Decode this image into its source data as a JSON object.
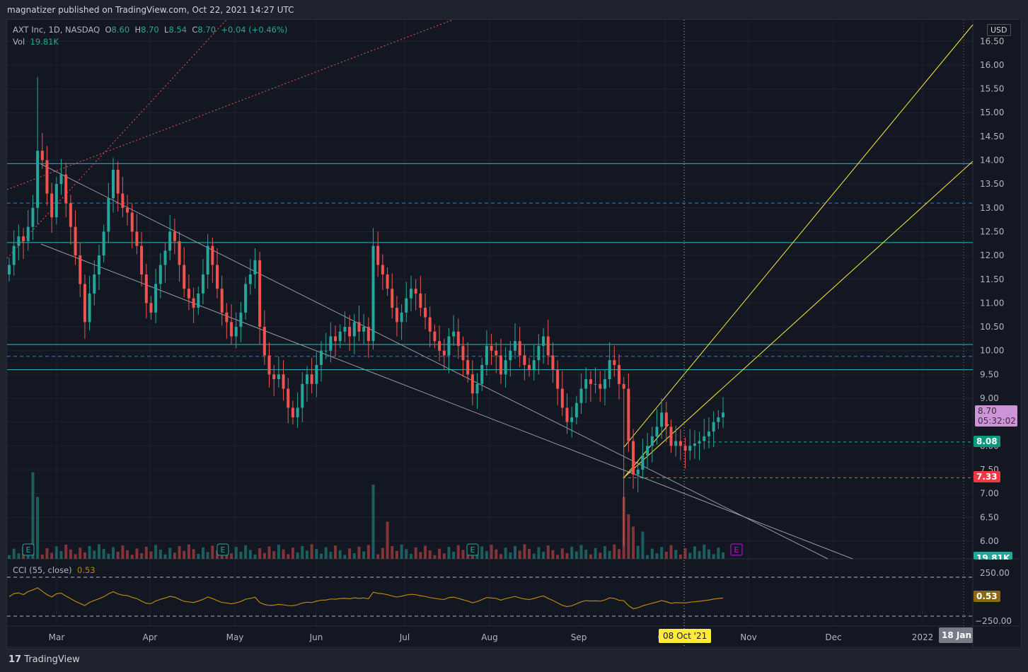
{
  "header": {
    "published": "magnatizer published on TradingView.com, Oct 22, 2021 14:27 UTC"
  },
  "legend": {
    "symbol": "AXT Inc, 1D, NASDAQ",
    "o_label": "O",
    "o": "8.60",
    "h_label": "H",
    "h": "8.70",
    "l_label": "L",
    "l": "8.54",
    "c_label": "C",
    "c": "8.70",
    "change": "+0.04 (+0.46%)",
    "vol_label": "Vol",
    "vol": "19.81K"
  },
  "currency": "USD",
  "price_tags": {
    "last": "8.70",
    "countdown": "05:32:02",
    "green": "8.08",
    "red": "7.33",
    "volume": "19.81K",
    "cci": "0.53"
  },
  "cci": {
    "label": "CCI (55, close)",
    "value": "0.53",
    "upper": "250.00",
    "lower": "−250.00"
  },
  "crosshair_date": "08 Oct '21",
  "end_date": "18 Jan '",
  "brand": "TradingView",
  "earnings_marker": "E",
  "colors": {
    "up": "#26a69a",
    "down": "#ef5350",
    "cci": "#b8860b",
    "level": "#2fb8c9",
    "trend": "#ffeb3b"
  },
  "chart_data": {
    "type": "candlestick",
    "title": "AXT Inc, 1D, NASDAQ",
    "ylim": [
      5.6,
      17.0
    ],
    "y_ticks": [
      6.0,
      6.5,
      7.0,
      7.5,
      8.0,
      8.5,
      9.0,
      9.5,
      10.0,
      10.5,
      11.0,
      11.5,
      12.0,
      12.5,
      13.0,
      13.5,
      14.0,
      14.5,
      15.0,
      15.5,
      16.0,
      16.5
    ],
    "x_ticks": [
      "Mar",
      "Apr",
      "May",
      "Jun",
      "Jul",
      "Aug",
      "Sep",
      "Oct",
      "Nov",
      "Dec",
      "2022"
    ],
    "closes": [
      11.8,
      12.2,
      12.4,
      12.3,
      12.6,
      13.0,
      14.2,
      14.0,
      13.3,
      12.8,
      13.5,
      13.7,
      13.1,
      12.6,
      12.0,
      11.4,
      10.6,
      11.2,
      11.6,
      12.0,
      12.5,
      13.2,
      13.8,
      13.3,
      13.0,
      12.9,
      12.5,
      12.2,
      11.6,
      11.0,
      10.8,
      11.4,
      11.8,
      12.1,
      12.5,
      12.3,
      11.8,
      11.3,
      11.1,
      10.9,
      11.2,
      11.6,
      12.2,
      11.8,
      11.3,
      10.8,
      10.6,
      10.3,
      10.5,
      10.8,
      11.4,
      11.6,
      11.9,
      10.5,
      9.9,
      9.5,
      9.4,
      9.5,
      9.2,
      8.8,
      8.6,
      8.8,
      9.3,
      9.5,
      9.3,
      9.7,
      10.0,
      10.0,
      10.3,
      10.2,
      10.4,
      10.5,
      10.3,
      10.6,
      10.4,
      10.5,
      10.2,
      12.2,
      11.8,
      11.6,
      11.3,
      10.9,
      10.6,
      10.8,
      11.1,
      11.3,
      11.2,
      10.9,
      10.7,
      10.4,
      10.2,
      10.0,
      9.9,
      10.3,
      10.4,
      10.1,
      9.8,
      9.5,
      9.1,
      9.3,
      9.7,
      10.1,
      10.0,
      9.9,
      9.5,
      9.8,
      10.0,
      10.2,
      9.9,
      9.7,
      9.6,
      9.8,
      10.1,
      10.3,
      9.9,
      9.6,
      9.2,
      8.8,
      8.5,
      8.6,
      8.9,
      9.2,
      9.4,
      9.3,
      9.3,
      9.2,
      9.4,
      9.8,
      9.7,
      9.3,
      9.2,
      8.1,
      7.4,
      7.5,
      7.8,
      8.0,
      8.2,
      8.4,
      8.7,
      8.4,
      8.0,
      8.1,
      8.0,
      7.9,
      8.0,
      8.05,
      8.1,
      8.2,
      8.3,
      8.5,
      8.6,
      8.7
    ],
    "horizontal_levels": [
      13.93,
      13.1,
      12.27,
      10.13,
      9.88,
      9.6,
      8.08,
      7.33
    ],
    "cci_range": [
      -250,
      250
    ]
  }
}
